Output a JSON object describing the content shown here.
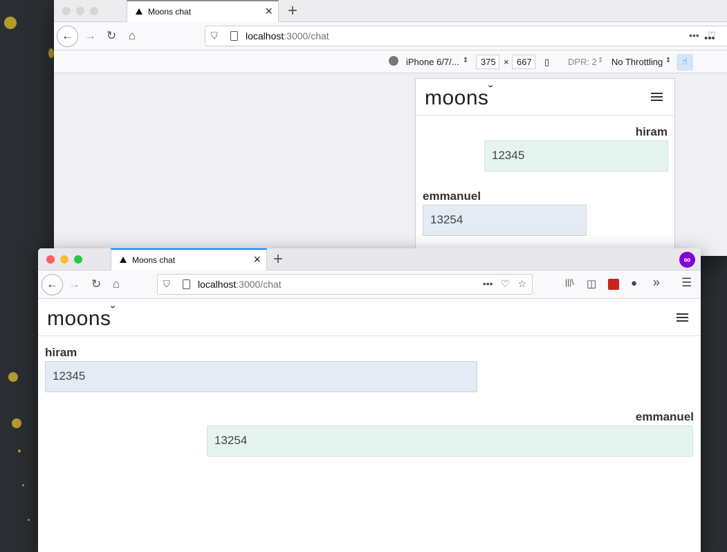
{
  "back_window": {
    "tab_title": "Moons chat",
    "url_host": "localhost",
    "url_path": ":3000/chat",
    "rdm": {
      "device": "iPhone 6/7/...",
      "width": "375",
      "times": "×",
      "height": "667",
      "dpr": "DPR: 2",
      "throttling": "No Throttling"
    },
    "logo": "moons",
    "messages": [
      {
        "author": "hiram",
        "text": "12345",
        "side": "right"
      },
      {
        "author": "emmanuel",
        "text": "13254",
        "side": "left"
      }
    ]
  },
  "front_window": {
    "tab_title": "Moons chat",
    "url_host": "localhost",
    "url_path": ":3000/chat",
    "logo": "moons",
    "messages": [
      {
        "author": "hiram",
        "text": "12345",
        "side": "left"
      },
      {
        "author": "emmanuel",
        "text": "13254",
        "side": "right"
      }
    ]
  },
  "colors": {
    "mine_bubble": "#e6f4ef",
    "theirs_bubble": "#e5ebf4",
    "tab_accent": "#0a84ff",
    "private_badge": "#8000d7"
  },
  "icons": {
    "back": "arrow-left-icon",
    "forward": "arrow-right-icon",
    "reload": "reload-icon",
    "home": "home-icon",
    "menu": "hamburger-icon"
  },
  "glyphs": {
    "back": "←",
    "forward": "→",
    "reload": "↻",
    "home": "⌂",
    "close": "×",
    "plus": "+",
    "more": "•••",
    "shield": "⛉",
    "star": "☆",
    "pocket": "♡",
    "menu": "☰",
    "library": "|||\\",
    "sidebar": "◫",
    "account": "●",
    "overflow": "»",
    "rotate": "▯",
    "touch": "☝",
    "arrows": "⇕",
    "moon": "˘",
    "mask": "∞"
  }
}
